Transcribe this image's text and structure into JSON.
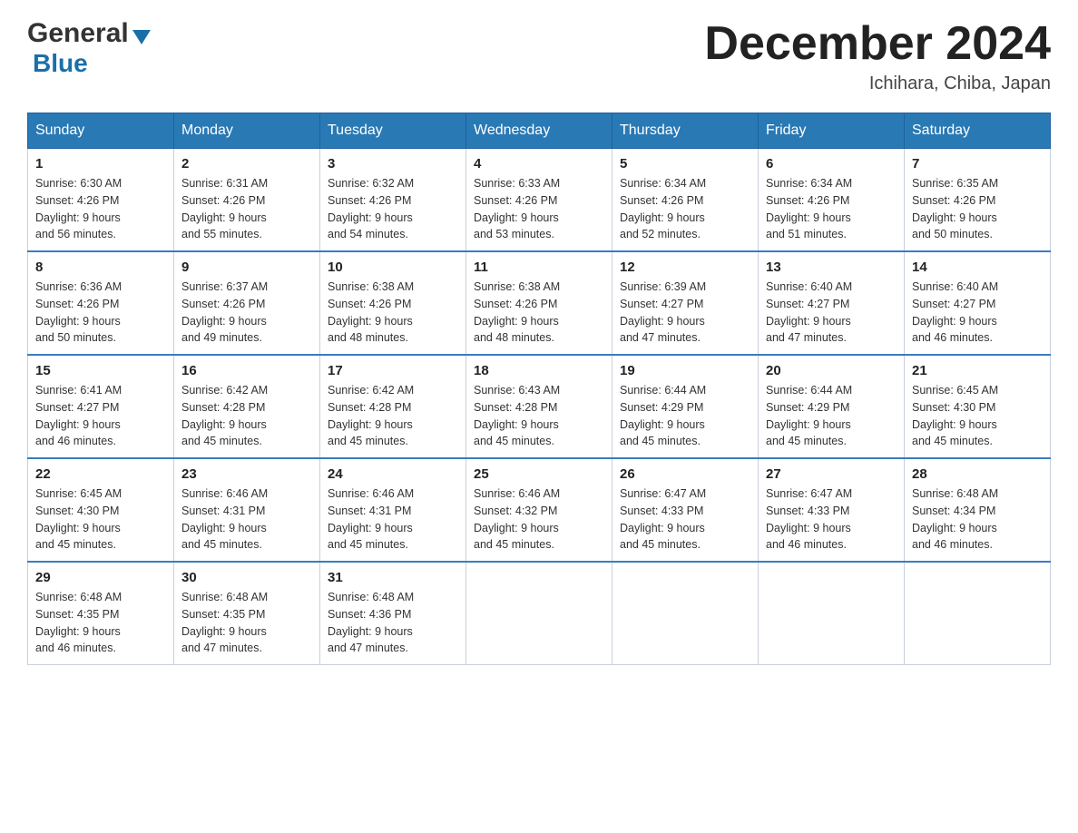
{
  "header": {
    "logo_general": "General",
    "logo_blue": "Blue",
    "month_title": "December 2024",
    "location": "Ichihara, Chiba, Japan"
  },
  "days_of_week": [
    "Sunday",
    "Monday",
    "Tuesday",
    "Wednesday",
    "Thursday",
    "Friday",
    "Saturday"
  ],
  "weeks": [
    [
      {
        "day": "1",
        "sunrise": "6:30 AM",
        "sunset": "4:26 PM",
        "daylight": "9 hours and 56 minutes."
      },
      {
        "day": "2",
        "sunrise": "6:31 AM",
        "sunset": "4:26 PM",
        "daylight": "9 hours and 55 minutes."
      },
      {
        "day": "3",
        "sunrise": "6:32 AM",
        "sunset": "4:26 PM",
        "daylight": "9 hours and 54 minutes."
      },
      {
        "day": "4",
        "sunrise": "6:33 AM",
        "sunset": "4:26 PM",
        "daylight": "9 hours and 53 minutes."
      },
      {
        "day": "5",
        "sunrise": "6:34 AM",
        "sunset": "4:26 PM",
        "daylight": "9 hours and 52 minutes."
      },
      {
        "day": "6",
        "sunrise": "6:34 AM",
        "sunset": "4:26 PM",
        "daylight": "9 hours and 51 minutes."
      },
      {
        "day": "7",
        "sunrise": "6:35 AM",
        "sunset": "4:26 PM",
        "daylight": "9 hours and 50 minutes."
      }
    ],
    [
      {
        "day": "8",
        "sunrise": "6:36 AM",
        "sunset": "4:26 PM",
        "daylight": "9 hours and 50 minutes."
      },
      {
        "day": "9",
        "sunrise": "6:37 AM",
        "sunset": "4:26 PM",
        "daylight": "9 hours and 49 minutes."
      },
      {
        "day": "10",
        "sunrise": "6:38 AM",
        "sunset": "4:26 PM",
        "daylight": "9 hours and 48 minutes."
      },
      {
        "day": "11",
        "sunrise": "6:38 AM",
        "sunset": "4:26 PM",
        "daylight": "9 hours and 48 minutes."
      },
      {
        "day": "12",
        "sunrise": "6:39 AM",
        "sunset": "4:27 PM",
        "daylight": "9 hours and 47 minutes."
      },
      {
        "day": "13",
        "sunrise": "6:40 AM",
        "sunset": "4:27 PM",
        "daylight": "9 hours and 47 minutes."
      },
      {
        "day": "14",
        "sunrise": "6:40 AM",
        "sunset": "4:27 PM",
        "daylight": "9 hours and 46 minutes."
      }
    ],
    [
      {
        "day": "15",
        "sunrise": "6:41 AM",
        "sunset": "4:27 PM",
        "daylight": "9 hours and 46 minutes."
      },
      {
        "day": "16",
        "sunrise": "6:42 AM",
        "sunset": "4:28 PM",
        "daylight": "9 hours and 45 minutes."
      },
      {
        "day": "17",
        "sunrise": "6:42 AM",
        "sunset": "4:28 PM",
        "daylight": "9 hours and 45 minutes."
      },
      {
        "day": "18",
        "sunrise": "6:43 AM",
        "sunset": "4:28 PM",
        "daylight": "9 hours and 45 minutes."
      },
      {
        "day": "19",
        "sunrise": "6:44 AM",
        "sunset": "4:29 PM",
        "daylight": "9 hours and 45 minutes."
      },
      {
        "day": "20",
        "sunrise": "6:44 AM",
        "sunset": "4:29 PM",
        "daylight": "9 hours and 45 minutes."
      },
      {
        "day": "21",
        "sunrise": "6:45 AM",
        "sunset": "4:30 PM",
        "daylight": "9 hours and 45 minutes."
      }
    ],
    [
      {
        "day": "22",
        "sunrise": "6:45 AM",
        "sunset": "4:30 PM",
        "daylight": "9 hours and 45 minutes."
      },
      {
        "day": "23",
        "sunrise": "6:46 AM",
        "sunset": "4:31 PM",
        "daylight": "9 hours and 45 minutes."
      },
      {
        "day": "24",
        "sunrise": "6:46 AM",
        "sunset": "4:31 PM",
        "daylight": "9 hours and 45 minutes."
      },
      {
        "day": "25",
        "sunrise": "6:46 AM",
        "sunset": "4:32 PM",
        "daylight": "9 hours and 45 minutes."
      },
      {
        "day": "26",
        "sunrise": "6:47 AM",
        "sunset": "4:33 PM",
        "daylight": "9 hours and 45 minutes."
      },
      {
        "day": "27",
        "sunrise": "6:47 AM",
        "sunset": "4:33 PM",
        "daylight": "9 hours and 46 minutes."
      },
      {
        "day": "28",
        "sunrise": "6:48 AM",
        "sunset": "4:34 PM",
        "daylight": "9 hours and 46 minutes."
      }
    ],
    [
      {
        "day": "29",
        "sunrise": "6:48 AM",
        "sunset": "4:35 PM",
        "daylight": "9 hours and 46 minutes."
      },
      {
        "day": "30",
        "sunrise": "6:48 AM",
        "sunset": "4:35 PM",
        "daylight": "9 hours and 47 minutes."
      },
      {
        "day": "31",
        "sunrise": "6:48 AM",
        "sunset": "4:36 PM",
        "daylight": "9 hours and 47 minutes."
      },
      null,
      null,
      null,
      null
    ]
  ],
  "labels": {
    "sunrise": "Sunrise:",
    "sunset": "Sunset:",
    "daylight": "Daylight:"
  }
}
